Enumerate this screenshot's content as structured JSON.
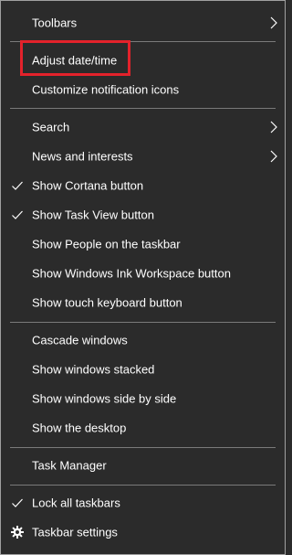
{
  "menu": {
    "items": [
      {
        "label": "Toolbars",
        "submenu": true
      },
      {
        "label": "Adjust date/time",
        "highlighted": true
      },
      {
        "label": "Customize notification icons"
      },
      {
        "label": "Search",
        "submenu": true
      },
      {
        "label": "News and interests",
        "submenu": true
      },
      {
        "label": "Show Cortana button",
        "checked": true
      },
      {
        "label": "Show Task View button",
        "checked": true
      },
      {
        "label": "Show People on the taskbar"
      },
      {
        "label": "Show Windows Ink Workspace button"
      },
      {
        "label": "Show touch keyboard button"
      },
      {
        "label": "Cascade windows"
      },
      {
        "label": "Show windows stacked"
      },
      {
        "label": "Show windows side by side"
      },
      {
        "label": "Show the desktop"
      },
      {
        "label": "Task Manager"
      },
      {
        "label": "Lock all taskbars",
        "checked": true
      },
      {
        "label": "Taskbar settings",
        "icon": "gear-icon"
      }
    ]
  },
  "colors": {
    "background": "#2b2b2b",
    "text": "#ffffff",
    "separator": "#7a7a7a",
    "highlight_border": "#e3222b"
  }
}
